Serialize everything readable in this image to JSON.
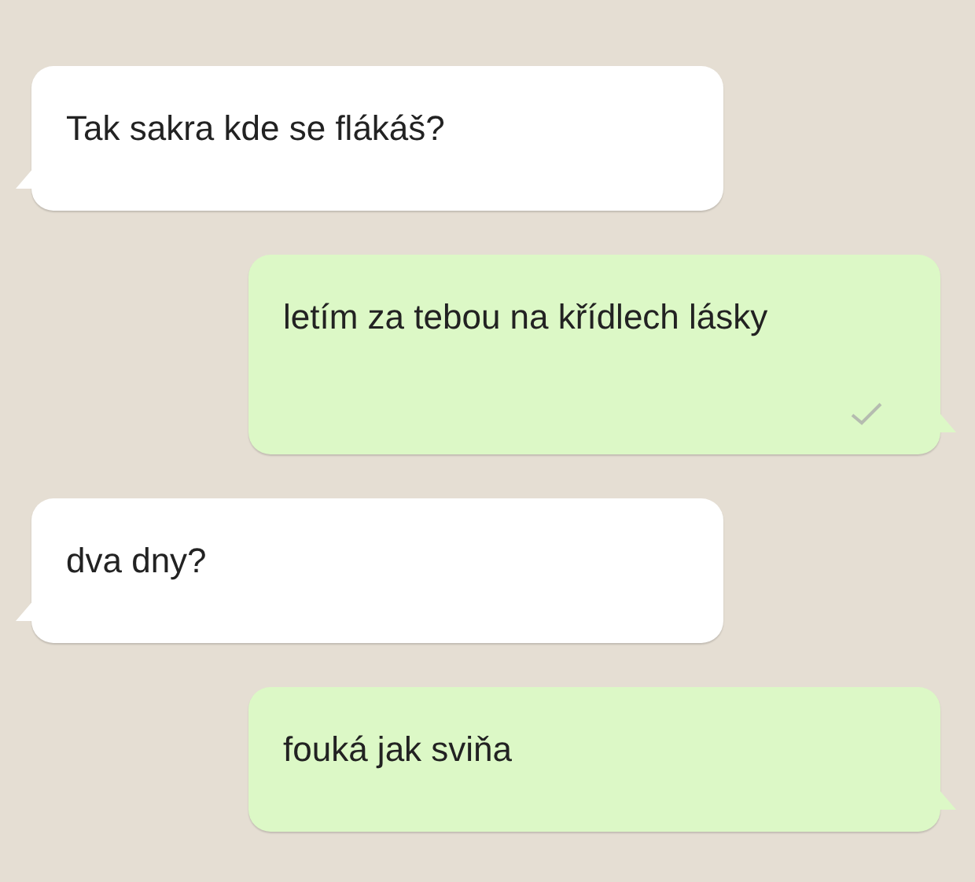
{
  "messages": [
    {
      "kind": "incoming",
      "text": "Tak sakra kde se flákáš?",
      "ticked": false
    },
    {
      "kind": "outgoing",
      "text": "letím za tebou na křídlech lásky",
      "ticked": true
    },
    {
      "kind": "incoming",
      "text": "dva dny?",
      "ticked": false
    },
    {
      "kind": "outgoing",
      "text": "fouká jak sviňa",
      "ticked": false
    }
  ]
}
